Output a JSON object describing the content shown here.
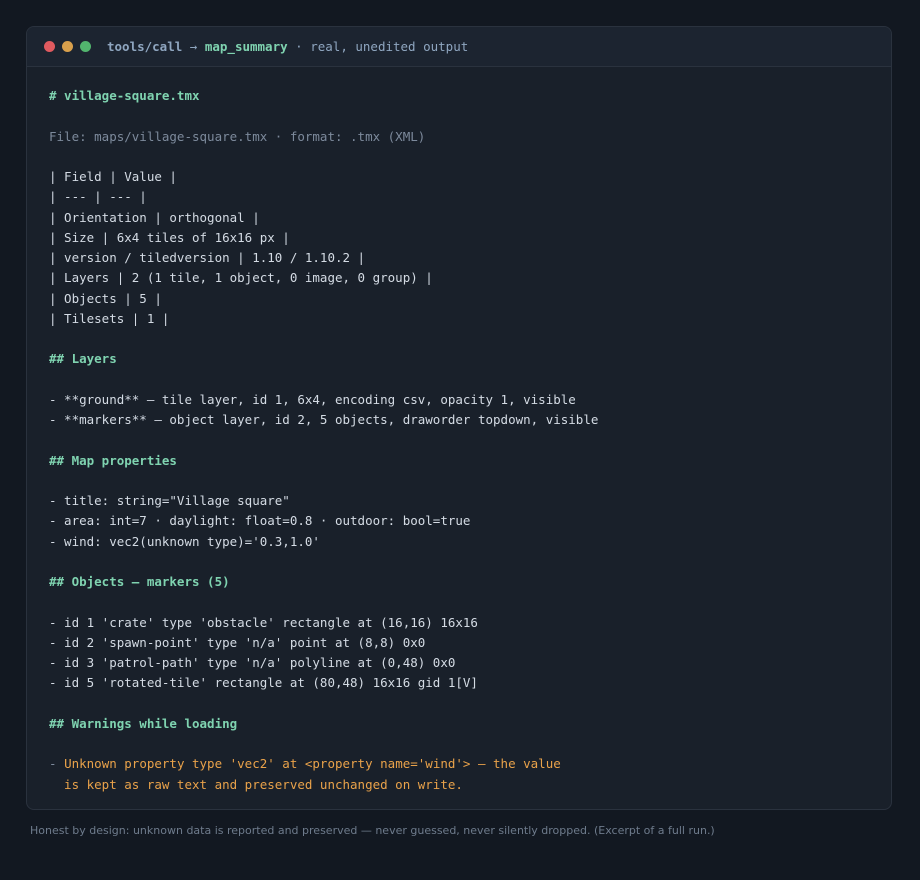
{
  "window": {
    "title_prefix": "tools/call",
    "title_arrow": " → ",
    "title_tool": "map_summary",
    "title_suffix": " · real, unedited output"
  },
  "output": {
    "heading": "# village-square.tmx",
    "file_line": "File: maps/village-square.tmx · format: .tmx (XML)",
    "table_lines": [
      "| Field | Value |",
      "| --- | --- |",
      "| Orientation | orthogonal |",
      "| Size | 6x4 tiles of 16x16 px |",
      "| version / tiledversion | 1.10 / 1.10.2 |",
      "| Layers | 2 (1 tile, 1 object, 0 image, 0 group) |",
      "| Objects | 5 |",
      "| Tilesets | 1 |"
    ],
    "layers_heading": "## Layers",
    "layers_lines": [
      "- **ground** — tile layer, id 1, 6x4, encoding csv, opacity 1, visible",
      "- **markers** — object layer, id 2, 5 objects, draworder topdown, visible"
    ],
    "props_heading": "## Map properties",
    "props_lines": [
      "- title: string=\"Village square\"",
      "- area: int=7 · daylight: float=0.8 · outdoor: bool=true",
      "- wind: vec2(unknown type)='0.3,1.0'"
    ],
    "objects_heading": "## Objects — markers (5)",
    "objects_lines": [
      "- id 1 'crate' type 'obstacle' rectangle at (16,16) 16x16",
      "- id 2 'spawn-point' type 'n/a' point at (8,8) 0x0",
      "- id 3 'patrol-path' type 'n/a' polyline at (0,48) 0x0",
      "- id 5 'rotated-tile' rectangle at (80,48) 16x16 gid 1[V]"
    ],
    "warnings_heading": "## Warnings while loading",
    "warning_bullet": "- ",
    "warning_lines": [
      "Unknown property type 'vec2' at <property name='wind'> — the value",
      "  is kept as raw text and preserved unchanged on write."
    ]
  },
  "caption": "Honest by design: unknown data is reported and preserved — never guessed, never silently dropped. (Excerpt of a full run.)",
  "colors": {
    "background": "#121821",
    "panel": "#19202a",
    "heading": "#7fd3b0",
    "warning": "#e9a24a",
    "window_close": "#e05a5f",
    "window_minimize": "#d9a04c",
    "window_maximize": "#52b56e"
  }
}
